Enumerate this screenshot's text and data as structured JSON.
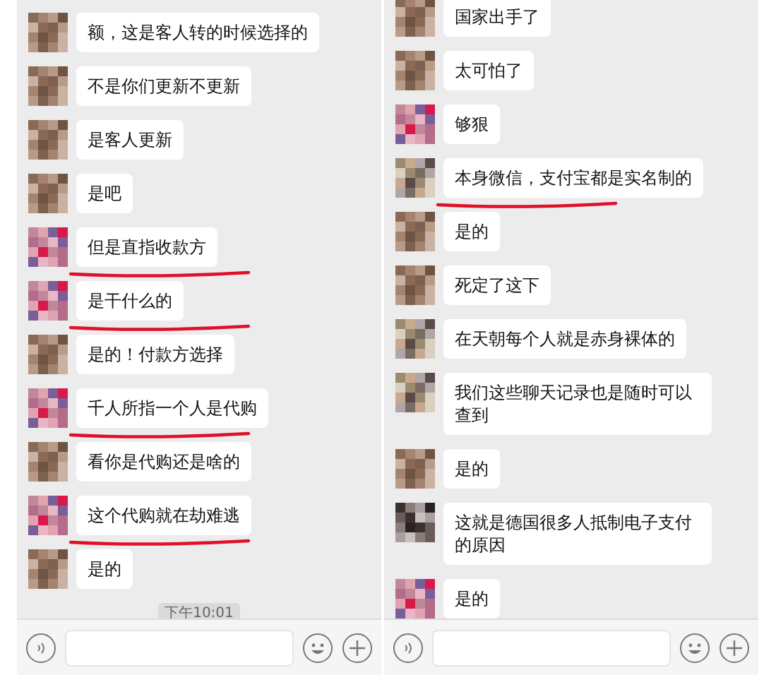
{
  "panels": [
    {
      "messages": [
        {
          "text": "额，这是客人转的时候选择的",
          "color": "#8a6a55",
          "underlined": false
        },
        {
          "text": "不是你们更新不更新",
          "color": "#8a6a55",
          "underlined": false
        },
        {
          "text": "是客人更新",
          "color": "#8a6a55",
          "underlined": false
        },
        {
          "text": "是吧",
          "color": "#8a6a55",
          "underlined": false
        },
        {
          "text": "但是直指收款方",
          "color": "#c0889a",
          "underlined": true
        },
        {
          "text": "是干什么的",
          "color": "#c0889a",
          "underlined": true
        },
        {
          "text": "是的！付款方选择",
          "color": "#8a6a55",
          "underlined": false
        },
        {
          "text": "千人所指一个人是代购",
          "color": "#c0889a",
          "underlined": true
        },
        {
          "text": "看你是代购还是啥的",
          "color": "#8a6a55",
          "underlined": false
        },
        {
          "text": "这个代购就在劫难逃",
          "color": "#c0889a",
          "underlined": true
        },
        {
          "text": "是的",
          "color": "#8a6a55",
          "underlined": false
        }
      ],
      "timestamp": "下午10:01"
    },
    {
      "messages": [
        {
          "text": "国家出手了",
          "color": "#8a6a55",
          "underlined": false
        },
        {
          "text": "太可怕了",
          "color": "#8a6a55",
          "underlined": false
        },
        {
          "text": "够狠",
          "color": "#c0889a",
          "underlined": false
        },
        {
          "text": "本身微信，支付宝都是实名制的",
          "color": "#9a8a70",
          "underlined": true
        },
        {
          "text": "是的",
          "color": "#8a6a55",
          "underlined": false
        },
        {
          "text": "死定了这下",
          "color": "#8a6a55",
          "underlined": false
        },
        {
          "text": "在天朝每个人就是赤身裸体的",
          "color": "#9a8a70",
          "underlined": false
        },
        {
          "text": "我们这些聊天记录也是随时可以查到",
          "color": "#9a8a70",
          "underlined": false
        },
        {
          "text": "是的",
          "color": "#8a6a55",
          "underlined": false
        },
        {
          "text": "这就是德国很多人抵制电子支付的原因",
          "color": "#3a3230",
          "underlined": false
        },
        {
          "text": "是的",
          "color": "#c0889a",
          "underlined": false
        }
      ]
    }
  ]
}
